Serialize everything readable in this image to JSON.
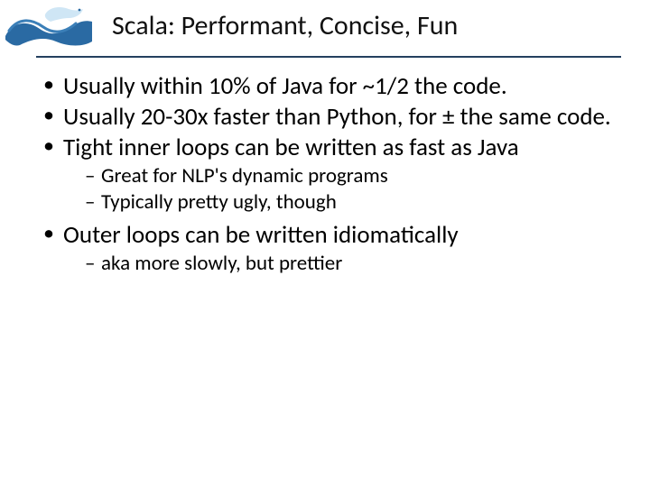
{
  "title": "Scala: Performant, Concise, Fun",
  "bullets": [
    {
      "text": "Usually within 10% of Java for ~1/2 the code."
    },
    {
      "text": "Usually 20-30x faster than Python, for ± the same code."
    },
    {
      "text": "Tight inner loops can be written as fast as Java",
      "sub": [
        "Great for NLP's dynamic programs",
        "Typically pretty ugly, though"
      ]
    },
    {
      "text": "Outer loops can be written idiomatically",
      "sub": [
        "aka more slowly, but prettier"
      ]
    }
  ]
}
